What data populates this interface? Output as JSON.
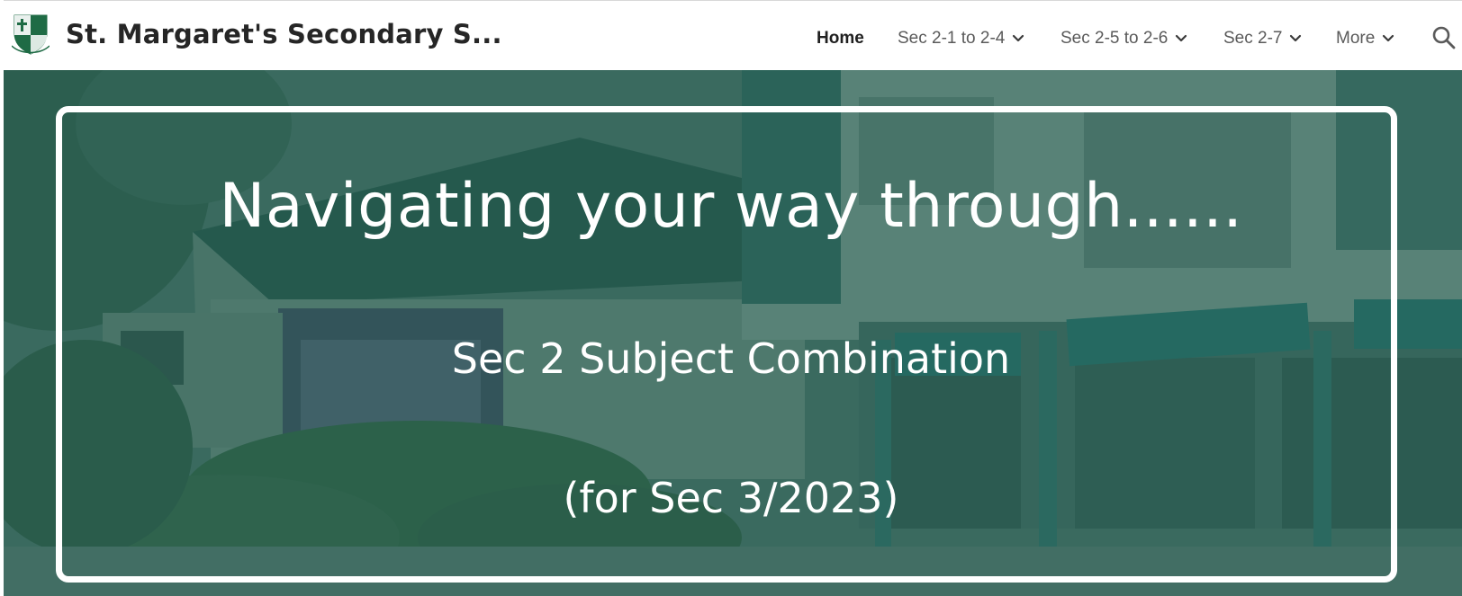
{
  "header": {
    "site_title": "St. Margaret's Secondary S...",
    "logo_icon": "school-crest-icon",
    "nav": [
      {
        "label": "Home",
        "active": true,
        "has_dropdown": false
      },
      {
        "label": "Sec 2-1 to 2-4",
        "active": false,
        "has_dropdown": true
      },
      {
        "label": "Sec 2-5 to 2-6",
        "active": false,
        "has_dropdown": true
      },
      {
        "label": "Sec 2-7",
        "active": false,
        "has_dropdown": true
      },
      {
        "label": "More",
        "active": false,
        "has_dropdown": true
      }
    ],
    "search_icon": "search-icon"
  },
  "hero": {
    "heading": "Navigating your way through......",
    "subheading": "Sec 2 Subject Combination",
    "note": "(for Sec 3/2023)",
    "overlay_color": "#1e5a4c",
    "frame_color": "#ffffff"
  },
  "brand": {
    "crest_green": "#1f6b45"
  }
}
